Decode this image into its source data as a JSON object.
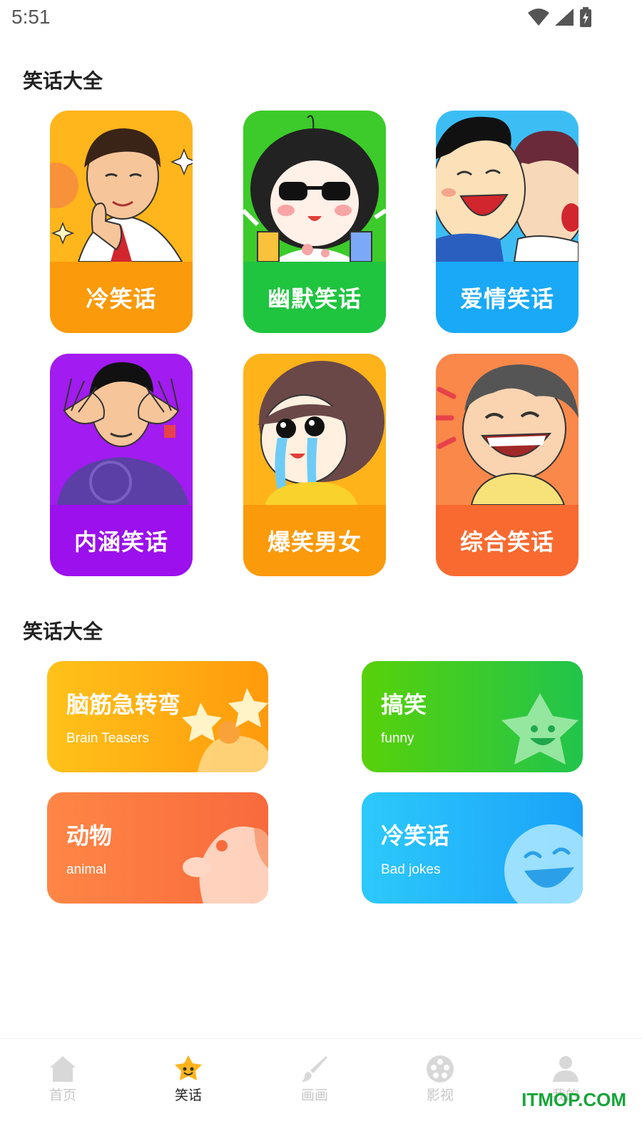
{
  "status_bar": {
    "time": "5:51"
  },
  "sections": [
    {
      "title": "笑话大全"
    },
    {
      "title": "笑话大全"
    }
  ],
  "categories": [
    {
      "label": "冷笑话",
      "color": "#FB9A0B"
    },
    {
      "label": "幽默笑话",
      "color": "#1FC43F"
    },
    {
      "label": "爱情笑话",
      "color": "#19A9F6"
    },
    {
      "label": "内涵笑话",
      "color": "#9B10EC"
    },
    {
      "label": "爆笑男女",
      "color": "#FB9A0B"
    },
    {
      "label": "综合笑话",
      "color": "#F86A30"
    }
  ],
  "features": [
    {
      "title": "脑筋急转弯",
      "subtitle": "Brain Teasers"
    },
    {
      "title": "搞笑",
      "subtitle": "funny"
    },
    {
      "title": "动物",
      "subtitle": "animal"
    },
    {
      "title": "冷笑话",
      "subtitle": "Bad jokes"
    }
  ],
  "nav": [
    {
      "label": "首页",
      "icon": "home-icon",
      "active": false
    },
    {
      "label": "笑话",
      "icon": "smiley-star-icon",
      "active": true
    },
    {
      "label": "画画",
      "icon": "brush-icon",
      "active": false
    },
    {
      "label": "影视",
      "icon": "film-reel-icon",
      "active": false
    },
    {
      "label": "我的",
      "icon": "user-icon",
      "active": false
    }
  ],
  "watermark": "ITMOP.COM"
}
